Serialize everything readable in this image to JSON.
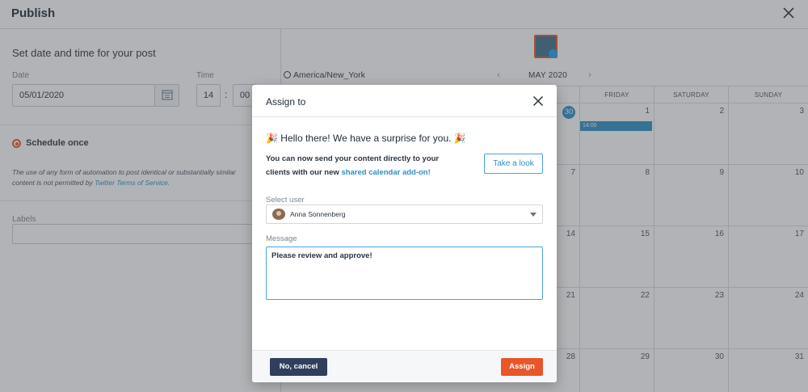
{
  "header": {
    "title": "Publish",
    "close_icon": "close-icon"
  },
  "schedule": {
    "heading": "Set date and time for your post",
    "date_label": "Date",
    "date_value": "05/01/2020",
    "time_label": "Time",
    "hour": "14",
    "minute": "00",
    "time_separator": ":",
    "option_label": "Schedule once",
    "notice_text": "The use of any form of automation to post identical or substantially similar content is not permitted by ",
    "notice_link": "Twitter Terms of Service.",
    "labels_label": "Labels"
  },
  "calendar": {
    "timezone": "America/New_York",
    "month": "MAY 2020",
    "prev_icon": "‹",
    "next_icon": "›",
    "columns": [
      "",
      "FRIDAY",
      "SATURDAY",
      "SUNDAY"
    ],
    "today": "30",
    "event_time": "14:00",
    "weeks": [
      [
        "30",
        "1",
        "2",
        "3"
      ],
      [
        "",
        "7",
        "8",
        "9",
        "10"
      ],
      [
        "",
        "14",
        "15",
        "16",
        "17"
      ],
      [
        "",
        "21",
        "22",
        "23",
        "24"
      ],
      [
        "",
        "28",
        "29",
        "30",
        "31"
      ]
    ]
  },
  "modal": {
    "title": "Assign to",
    "hello": "🎉 Hello there! We have a surprise for you. 🎉",
    "body_text": "You can now send your content directly to your clients with our new ",
    "body_link": "shared calendar add-on!",
    "take_look": "Take a look",
    "select_label": "Select user",
    "selected_user": "Anna Sonnenberg",
    "message_label": "Message",
    "message_value": "Please review and approve!",
    "cancel": "No, cancel",
    "assign": "Assign"
  },
  "colors": {
    "accent": "#e8562a",
    "link": "#2d8fc7",
    "cancel_button": "#2f3f5c"
  }
}
